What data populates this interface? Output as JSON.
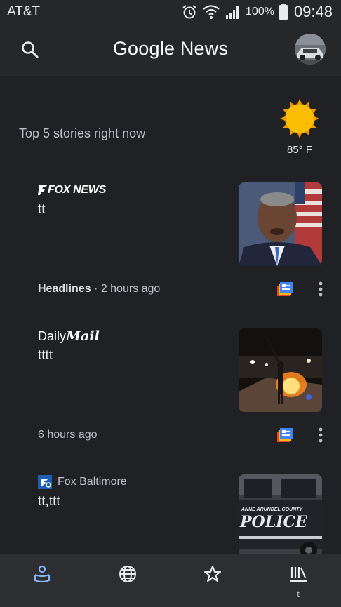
{
  "status": {
    "carrier": "AT&T",
    "battery": "100%",
    "time": "09:48",
    "icons": [
      "alarm-icon",
      "wifi-icon",
      "signal-icon",
      "battery-icon"
    ]
  },
  "app": {
    "title": "Google News"
  },
  "top_stories": {
    "header": "Top 5 stories right now",
    "weather": {
      "temp": "85° F",
      "icon": "sun-icon"
    }
  },
  "stories": [
    {
      "source": "FOX NEWS",
      "headline": "tt",
      "category": "Headlines",
      "time": " · 2 hours ago"
    },
    {
      "source_part1": "Daily",
      "source_part2": "Mail",
      "headline": "tttt",
      "time": "6 hours ago"
    },
    {
      "source": "Fox Baltimore",
      "headline": "tt,ttt",
      "thumb_text": "POLICE",
      "thumb_subtext": "ANNE ARUNDEL COUNTY"
    }
  ],
  "nav": {
    "items": [
      {
        "icon": "for-you-icon",
        "label": ""
      },
      {
        "icon": "globe-icon",
        "label": ""
      },
      {
        "icon": "star-icon",
        "label": ""
      },
      {
        "icon": "newsstand-icon",
        "label": "t"
      }
    ]
  },
  "colors": {
    "background": "#202124",
    "app_bar": "#26272b",
    "accent_blue": "#8ab4f8",
    "sun": "#fbbc04"
  }
}
